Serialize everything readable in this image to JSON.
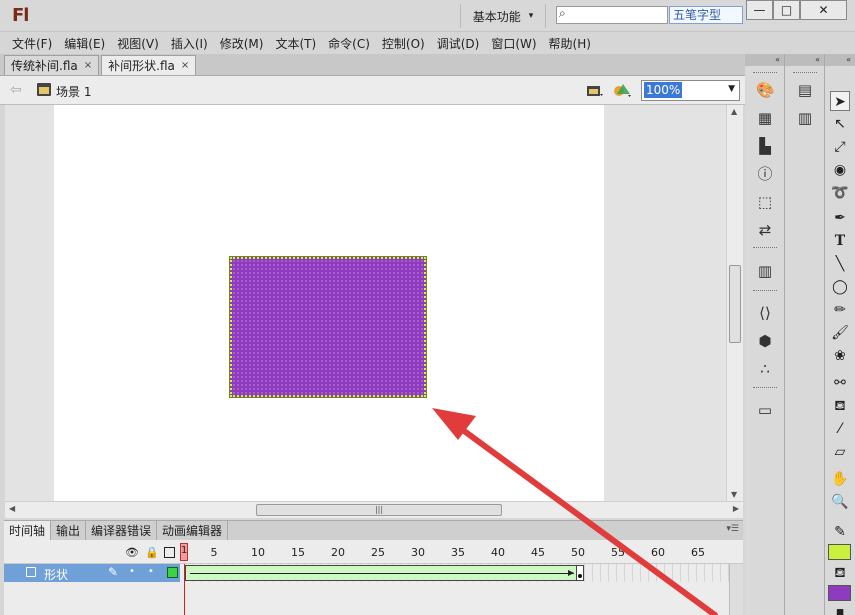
{
  "app": {
    "logo": "Fl",
    "workspace": "基本功能",
    "search_placeholder": "",
    "ime_label": "五笔字型",
    "window_buttons": {
      "minimize": "—",
      "maximize": "□",
      "close": "✕"
    }
  },
  "menu": [
    "文件(F)",
    "编辑(E)",
    "视图(V)",
    "插入(I)",
    "修改(M)",
    "文本(T)",
    "命令(C)",
    "控制(O)",
    "调试(D)",
    "窗口(W)",
    "帮助(H)"
  ],
  "doc_tabs": [
    {
      "label": "传统补间.fla",
      "close": "×",
      "active": false
    },
    {
      "label": "补间形状.fla",
      "close": "×",
      "active": true
    }
  ],
  "editbar": {
    "scene": "场景 1",
    "zoom": "100%"
  },
  "stage": {
    "shape_color": "#8f3bbf",
    "selection_color": "#d7f23c"
  },
  "timeline": {
    "tabs": [
      "时间轴",
      "输出",
      "编译器错误",
      "动画编辑器"
    ],
    "ruler": [
      "1",
      "5",
      "10",
      "15",
      "20",
      "25",
      "30",
      "35",
      "40",
      "45",
      "50",
      "55",
      "60",
      "65"
    ],
    "current_frame": "1",
    "layer_name": "形状",
    "layer_state_dots": [
      "•",
      "•"
    ],
    "tween_end_frame": 50
  },
  "dock": {
    "collapse": "«",
    "panel_icons": [
      "color-icon",
      "swatches-icon",
      "align-icon",
      "info-icon",
      "transform-icon",
      "code-snippets-icon",
      "library-icon",
      "actions-icon",
      "components-icon",
      "motion-presets-icon",
      "project-icon"
    ],
    "tools": [
      "selection-tool",
      "subselection-tool",
      "free-transform-tool",
      "3d-rotation-tool",
      "lasso-tool",
      "pen-tool",
      "text-tool",
      "line-tool",
      "oval-tool",
      "pencil-tool",
      "brush-tool",
      "deco-tool",
      "bone-tool",
      "paint-bucket-tool",
      "eyedropper-tool",
      "eraser-tool",
      "hand-tool",
      "zoom-tool"
    ],
    "stroke_color": "#c8f03c",
    "fill_color": "#8f3bbf"
  },
  "annotation_color": "#e03c3c"
}
